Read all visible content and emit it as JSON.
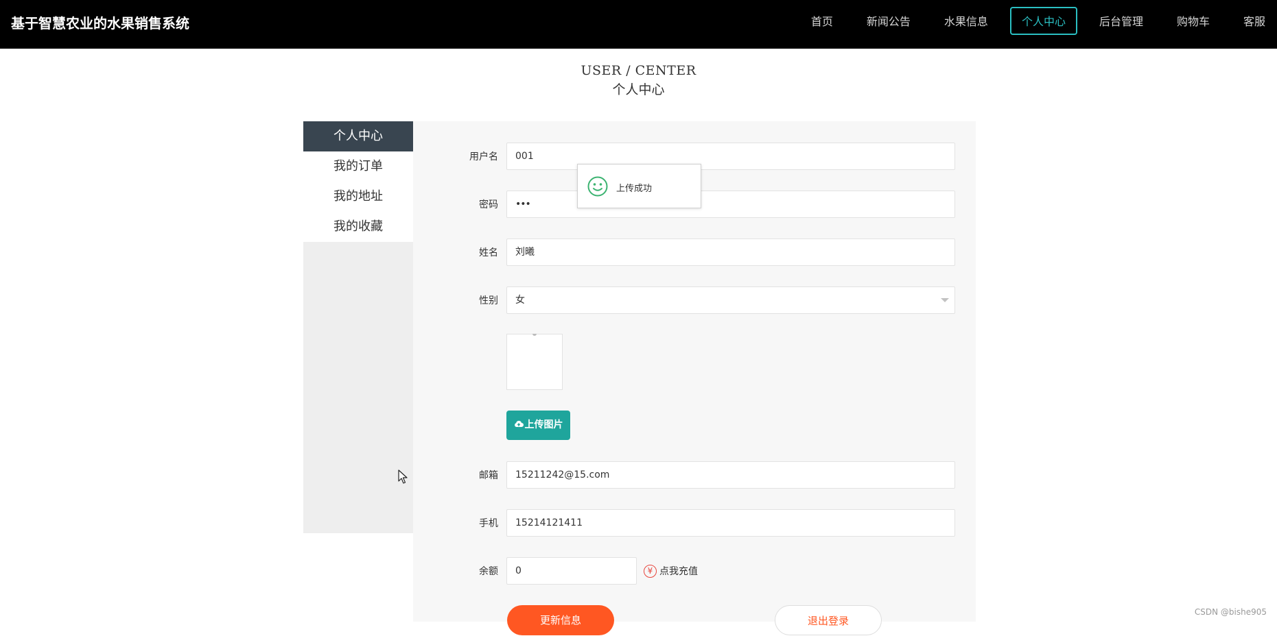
{
  "header": {
    "brand": "基于智慧农业的水果销售系统",
    "nav": [
      {
        "label": "首页",
        "active": false
      },
      {
        "label": "新闻公告",
        "active": false
      },
      {
        "label": "水果信息",
        "active": false
      },
      {
        "label": "个人中心",
        "active": true
      },
      {
        "label": "后台管理",
        "active": false
      },
      {
        "label": "购物车",
        "active": false
      },
      {
        "label": "客服",
        "active": false
      }
    ]
  },
  "page_title": {
    "en": "USER / CENTER",
    "cn": "个人中心"
  },
  "sidebar": {
    "items": [
      {
        "label": "个人中心",
        "active": true
      },
      {
        "label": "我的订单",
        "active": false
      },
      {
        "label": "我的地址",
        "active": false
      },
      {
        "label": "我的收藏",
        "active": false
      }
    ]
  },
  "form": {
    "username": {
      "label": "用户名",
      "value": "001"
    },
    "password": {
      "label": "密码",
      "value": "•••"
    },
    "name": {
      "label": "姓名",
      "value": "刘曦"
    },
    "gender": {
      "label": "性别",
      "value": "女"
    },
    "upload_button": "上传图片",
    "email": {
      "label": "邮箱",
      "value": "15211242@15.com"
    },
    "phone": {
      "label": "手机",
      "value": "15214121411"
    },
    "balance": {
      "label": "余额",
      "value": "0"
    },
    "recharge": {
      "label": "点我充值",
      "icon": "¥"
    },
    "update_button": "更新信息",
    "logout_button": "退出登录"
  },
  "toast": {
    "message": "上传成功",
    "icon": "smile-icon"
  },
  "watermark": "CSDN @bishe905",
  "colors": {
    "topbar": "#000000",
    "accent": "#2bc0c3",
    "sidebar_active": "#394550",
    "upload": "#1fa59c",
    "primary": "#ff5722"
  }
}
